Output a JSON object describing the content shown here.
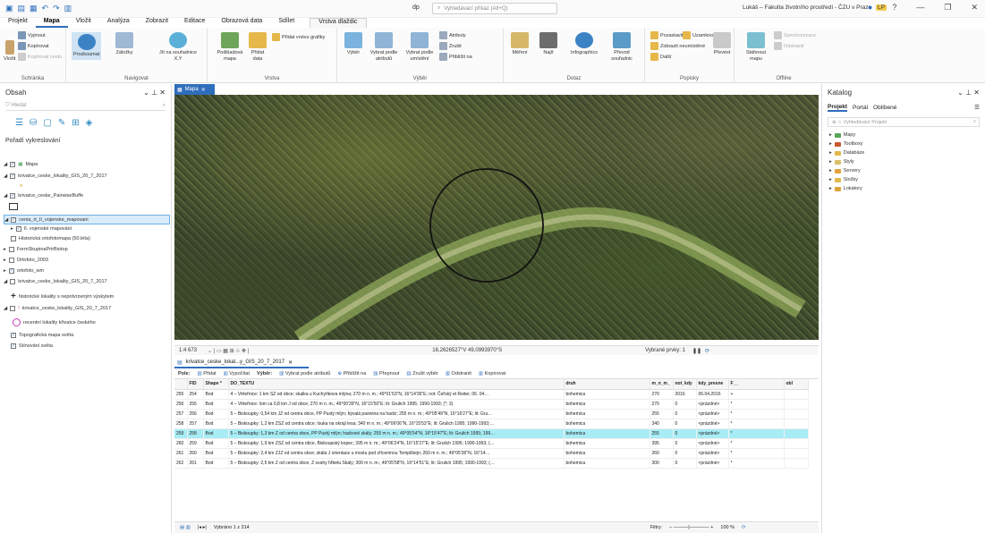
{
  "titlebar": {
    "app_name": "dp",
    "search_placeholder": "Vyhledávací příkaz (Alt+Q)",
    "user": "Lukáš – Fakulta životního prostředí - ČZU v Praze",
    "user_badge": "LP"
  },
  "menu": [
    "Projekt",
    "Mapa",
    "Vložit",
    "Analýza",
    "Zobrazit",
    "Editace",
    "Obrazová data",
    "Sdílet",
    "Vrstva dlaždic"
  ],
  "ribbon": {
    "schranka": {
      "title": "Schránka",
      "vlozit": "Vložit",
      "vyjmout": "Vyjmout",
      "kopirovat": "Kopírovat",
      "kopirovat_cestu": "Kopírovat cestu"
    },
    "navigovat": {
      "title": "Navigovat",
      "prozkoumat": "Prozkoumat",
      "zalozky": "Záložky",
      "jit_na": "Jít na souřadnice X,Y"
    },
    "vrstva": {
      "title": "Vrstva",
      "podkladova": "Podkladová mapa",
      "pridat_data": "Přidat data",
      "pridat_vrstvu": "Přidat vrstvu grafiky"
    },
    "vyber": {
      "title": "Výběr",
      "vyber": "Výběr",
      "podle_atributu": "Vybrat podle atributů",
      "podle_umisteni": "Vybrat podle umístění",
      "atributy": "Atributy",
      "zrusit": "Zrušit",
      "priblizit": "Přiblížit na"
    },
    "dotaz": {
      "title": "Dotaz",
      "mereni": "Měření",
      "najit": "Najít",
      "umisteni": "umístění",
      "infographics": "Infographics",
      "prevod": "Převod souřadnic"
    },
    "popisky": {
      "title": "Popisky",
      "pozastavit": "Pozastavit",
      "uzamknout": "Uzamknout",
      "zobrazit": "Zobrazit neumístěné",
      "dalsi": "Další",
      "prevest": "Převést"
    },
    "offline": {
      "title": "Offline",
      "stahnout": "Stáhnout mapu",
      "synchronizace": "Synchronizace",
      "odstranit": "Odstranit"
    }
  },
  "contents": {
    "title": "Obsah",
    "filter_placeholder": "Hledat",
    "drawing_order": "Pořadí vykreslování",
    "items": [
      {
        "label": "Mapa",
        "checked": true
      },
      {
        "label": "krivatce_ceske_lokality_GIS_20_7_2017",
        "checked": true
      },
      {
        "label": "krivatce_ceske_PairwiseBuffe",
        "checked": true
      },
      {
        "label": "cenia_rt_II_vojenske_mapovani",
        "checked": true
      },
      {
        "label": "II. vojenské mapování",
        "checked": true
      },
      {
        "label": "Historická ortofotomapa (50.léta)",
        "checked": false
      },
      {
        "label": "FormSkupinaPrirBiotop",
        "checked": false
      },
      {
        "label": "Ortofoto_2003",
        "checked": false
      },
      {
        "label": "ortofoto_wm",
        "checked": true
      },
      {
        "label": "krivatce_ceske_lokality_GIS_20_7_2017",
        "checked": false
      },
      {
        "label": "historické lokality s nepotvrzeným výskytem",
        "checked": false
      },
      {
        "label": "krivatce_ceske_lokality_GIS_20_7_2017",
        "checked": false
      },
      {
        "label": "recentní lokality křivatce českého",
        "checked": false
      },
      {
        "label": "Topografická mapa světa",
        "checked": true
      },
      {
        "label": "Stínování světa",
        "checked": true
      }
    ]
  },
  "map": {
    "tab_label": "Mapa",
    "scale": "1:4 673",
    "coordinates": "16,2626527°V 49,0993970°S",
    "selected_features": "Vybrané prvky: 1"
  },
  "table": {
    "tab_label": "krivatce_ceske_lokal...y_GIS_20_7_2017",
    "toolbar": {
      "pole": "Pole:",
      "pridat": "Přidat",
      "vypocitat": "Vypočítat",
      "vyber": "Výběr:",
      "podle_atributu": "Vybrat podle atributů",
      "priblizit": "Přiblížit na",
      "prepnout": "Přepnout",
      "zrusit": "Zrušit výběr",
      "odstranit": "Odstranit",
      "kopirovat": "Kopírovat"
    },
    "columns": [
      "",
      "FID",
      "Shape *",
      "DO_TEXTU",
      "druh",
      "m_n_m_",
      "not_kdy",
      "kdy_presne",
      "F__",
      "obl"
    ],
    "rows": [
      [
        "255",
        "254",
        "Bod",
        "4 – Věteřnice: 1 km SZ od obce; skalka u Kuchyňkova mlýna; 270 m n. m.; 49°01'53\"N, 16°14'36\"E; not: Čeřský et Reiter, 06. 04…",
        "bohemica",
        "270",
        "2016",
        "06.04.2016",
        "+",
        ""
      ],
      [
        "256",
        "255",
        "Bod",
        "4 – Věteřnice: lom ca 0,8 km J od obce; 270 m n. m.; 49°00'39\"N, 16°15'50\"E; lit: Grulich 1995; 1990-1993; (*; 3)",
        "bohemica",
        "270",
        "0",
        "<prázdné>",
        "*",
        ""
      ],
      [
        "257",
        "256",
        "Bod",
        "5 – Biskoupky: 0,54 km JZ od centra obce, PP Pustý mlýn; bývalá pastvina na hadci; 255 m n. m.; 49°05'49\"N, 16°16'27\"E; lit: Gru…",
        "bohemica",
        "255",
        "0",
        "<prázdné>",
        "*",
        ""
      ],
      [
        "258",
        "257",
        "Bod",
        "5 – Biskoupky: 1,2 km ZSZ od centra obce; louka na okraji lesa; 340 m n. m.; 49°06'06\"N, 16°15'53\"E; lit: Grulich 1995; 1990-1993;…",
        "bohemica",
        "340",
        "0",
        "<prázdné>",
        "*",
        ""
      ],
      [
        "259",
        "258",
        "Bod",
        "5 – Biskoupky: 1,3 km Z od centra obce, PP Pustý mlýn; hadcové skály; 255 m n. m.; 49°05'54\"N, 16°15'47\"E; lit: Grulich 1995; 199…",
        "bohemica",
        "255",
        "0",
        "<prázdné>",
        "*",
        ""
      ],
      [
        "260",
        "259",
        "Bod",
        "5 – Biskoupky: 1,9 km ZSZ od centra obce, Biskoupský kopec; 395 m n. m.; 49°06'24\"N, 16°15'27\"E; lit: Grulich 1995; 1990-1993; (…",
        "bohemica",
        "395",
        "0",
        "<prázdné>",
        "*",
        ""
      ],
      [
        "261",
        "260",
        "Bod",
        "5 – Biskoupky: 2,4 km ZJZ od centra obce; skála J orientace u mostu pod zříceninou Templštejn; 260 m n. m.; 49°05'36\"N, 16°14…",
        "bohemica",
        "260",
        "0",
        "<prázdné>",
        "*",
        ""
      ],
      [
        "262",
        "261",
        "Bod",
        "5 – Biskoupky: 2,5 km Z od centra obce, Z svahy hřbetu Skály; 300 m n. m.; 49°05'58\"N, 16°14'51\"E; lit: Grulich 1995; 1990-1993; (…",
        "bohemica",
        "300",
        "0",
        "<prázdné>",
        "*",
        ""
      ]
    ],
    "highlight_row": 4,
    "status": "Vybráno 1 z 314",
    "filters": "Filtry:",
    "zoom": "100 %"
  },
  "catalog": {
    "title": "Katalog",
    "tabs": [
      "Projekt",
      "Portál",
      "Oblíbené"
    ],
    "search_placeholder": "Vyhledávání Projekt",
    "items": [
      "Mapy",
      "Toolboxy",
      "Databáze",
      "Styly",
      "Servery",
      "Složky",
      "Lokátory"
    ]
  },
  "colors": {
    "accent": "#2f6ebc",
    "highlight_row": "#a8ecf5",
    "selected_layer": "#d9ecfa"
  }
}
